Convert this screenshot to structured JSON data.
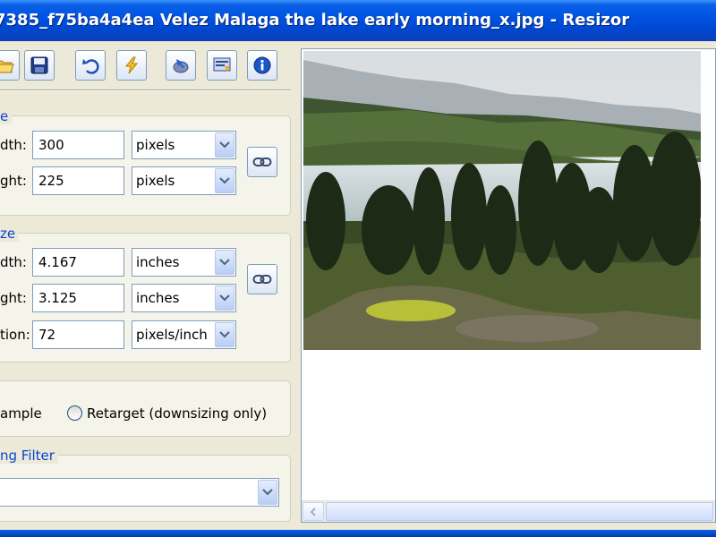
{
  "window": {
    "title": "7385_f75ba4a4ea Velez Malaga the lake early morning_x.jpg - Resizor"
  },
  "toolbar": {
    "buttons": [
      {
        "name": "open-button",
        "icon": "folder-open-icon"
      },
      {
        "name": "save-button",
        "icon": "floppy-disk-icon"
      },
      {
        "name": "undo-button",
        "icon": "undo-arrow-icon"
      },
      {
        "name": "resize-button",
        "icon": "lightning-icon"
      },
      {
        "name": "batch-button",
        "icon": "disk-arrow-icon"
      },
      {
        "name": "settings-button",
        "icon": "settings-icon"
      },
      {
        "name": "about-button",
        "icon": "info-icon"
      }
    ]
  },
  "pixel_size": {
    "legend": "e",
    "width_label": "dth:",
    "width_value": "300",
    "width_unit": "pixels",
    "height_label": "ght:",
    "height_value": "225",
    "height_unit": "pixels"
  },
  "print_size": {
    "legend": "ze",
    "width_label": "dth:",
    "width_value": "4.167",
    "width_unit": "inches",
    "height_label": "ght:",
    "height_value": "3.125",
    "height_unit": "inches",
    "resolution_label": "tion:",
    "resolution_value": "72",
    "resolution_unit": "pixels/inch"
  },
  "method": {
    "resample_label": "ample",
    "retarget_label": "Retarget (downsizing only)"
  },
  "filter": {
    "legend": "ng Filter",
    "value": ""
  },
  "colors": {
    "title_bar": "#0054e3",
    "legend_text": "#0046d5",
    "window_bg": "#ece9d8"
  }
}
